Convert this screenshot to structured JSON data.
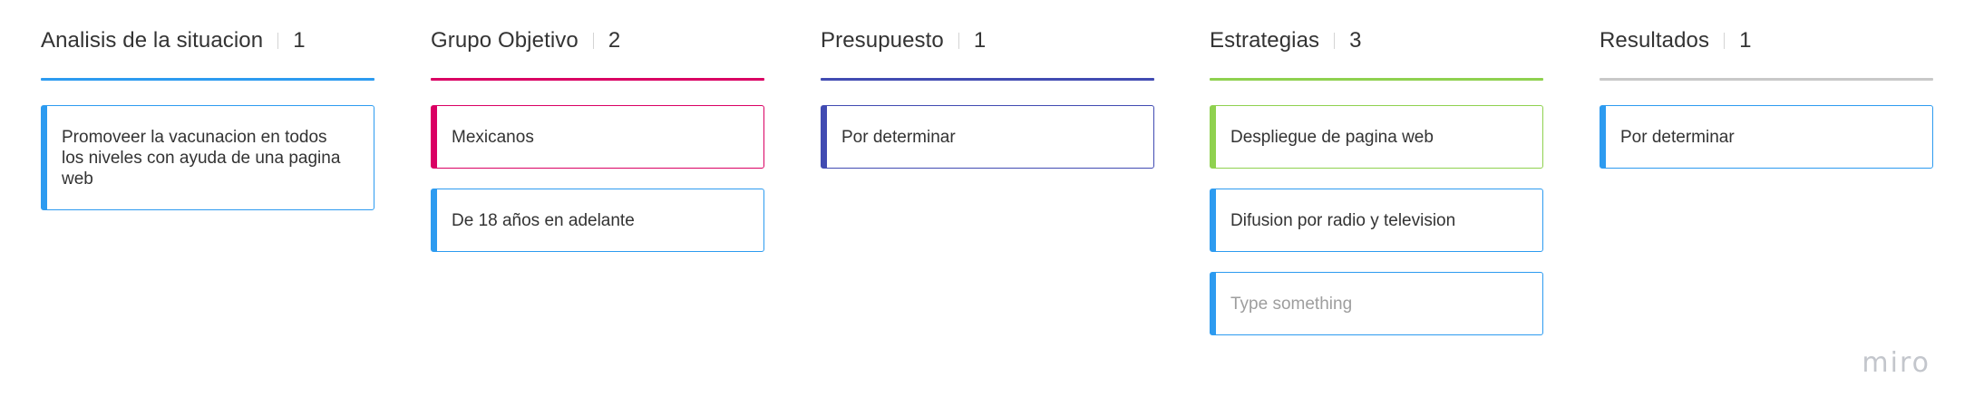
{
  "board": {
    "columns": [
      {
        "title": "Analisis de la situacion",
        "count": "1",
        "accent": "#2d9bf0",
        "cards": [
          {
            "text": "Promoveer la vacunacion en todos los niveles con ayuda de una pagina web",
            "accent": "#2d9bf0"
          }
        ]
      },
      {
        "title": "Grupo Objetivo",
        "count": "2",
        "accent": "#da0063",
        "cards": [
          {
            "text": "Mexicanos",
            "accent": "#da0063"
          },
          {
            "text": "De 18 años en adelante",
            "accent": "#2d9bf0"
          }
        ]
      },
      {
        "title": "Presupuesto",
        "count": "1",
        "accent": "#414bb2",
        "cards": [
          {
            "text": "Por determinar",
            "accent": "#414bb2"
          }
        ]
      },
      {
        "title": "Estrategias",
        "count": "3",
        "accent": "#8fd14f",
        "cards": [
          {
            "text": "Despliegue de pagina web",
            "accent": "#8fd14f"
          },
          {
            "text": "Difusion por radio y television",
            "accent": "#2d9bf0"
          },
          {
            "placeholder": "Type something",
            "accent": "#2d9bf0"
          }
        ]
      },
      {
        "title": "Resultados",
        "count": "1",
        "accent": "#c8c8c8",
        "cards": [
          {
            "text": "Por determinar",
            "accent": "#2d9bf0"
          }
        ]
      }
    ]
  },
  "logo": {
    "text": "miro"
  }
}
